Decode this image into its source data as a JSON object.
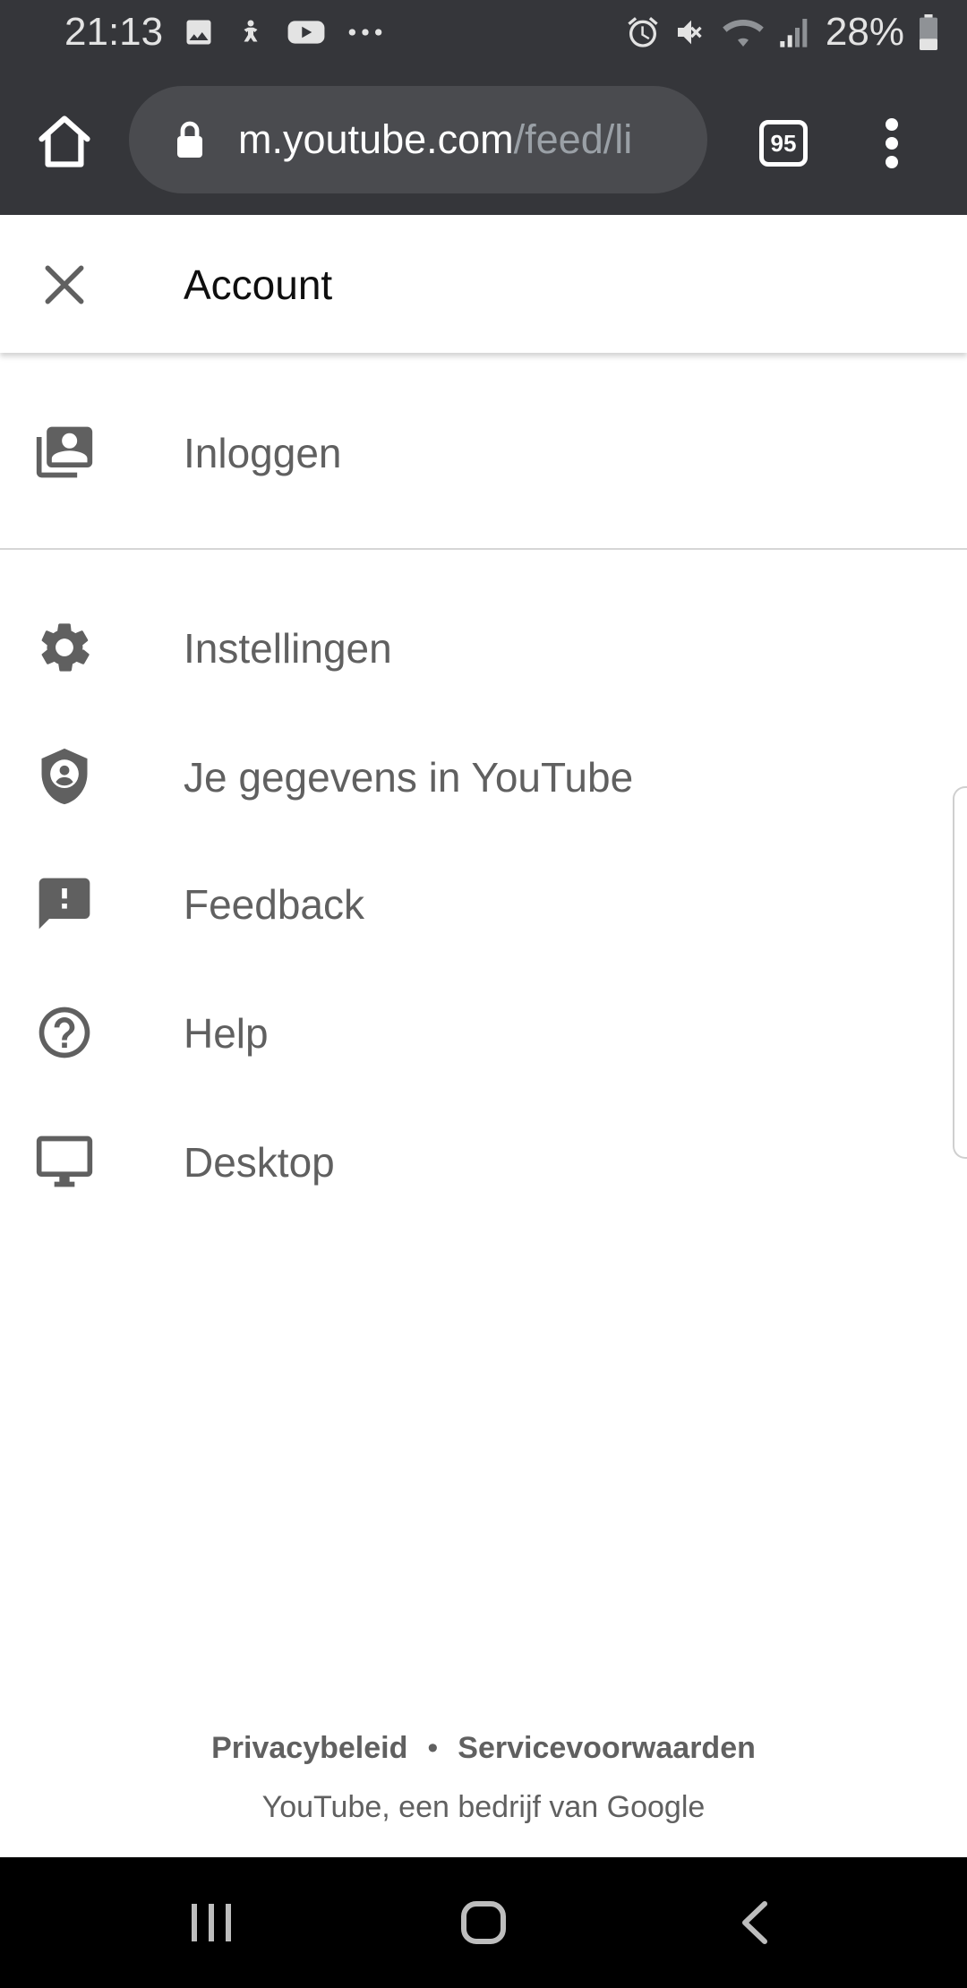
{
  "status_bar": {
    "time": "21:13",
    "battery": "28%",
    "left_icons": [
      "image-icon",
      "download-icon",
      "youtube-icon",
      "more-notifications-icon"
    ],
    "right_icons": [
      "alarm-icon",
      "mute-icon",
      "wifi-icon",
      "signal-icon",
      "battery-icon"
    ]
  },
  "browser": {
    "url_host": "m.youtube.com",
    "url_path": "/feed/li",
    "tab_count": "95"
  },
  "header": {
    "title": "Account"
  },
  "menu": {
    "items": [
      {
        "label": "Inloggen",
        "icon": "account-box-icon"
      },
      {
        "label": "Instellingen",
        "icon": "gear-icon"
      },
      {
        "label": "Je gegevens in YouTube",
        "icon": "shield-person-icon"
      },
      {
        "label": "Feedback",
        "icon": "feedback-icon"
      },
      {
        "label": "Help",
        "icon": "help-icon"
      },
      {
        "label": "Desktop",
        "icon": "desktop-icon"
      }
    ]
  },
  "footer": {
    "privacy": "Privacybeleid",
    "separator": "•",
    "terms": "Servicevoorwaarden",
    "company": "YouTube, een bedrijf van Google"
  },
  "colors": {
    "toolbar": "#35363a",
    "url_pill": "#4a4b4f",
    "icon": "#606060",
    "label": "#606060",
    "title": "#0f0f0f"
  }
}
